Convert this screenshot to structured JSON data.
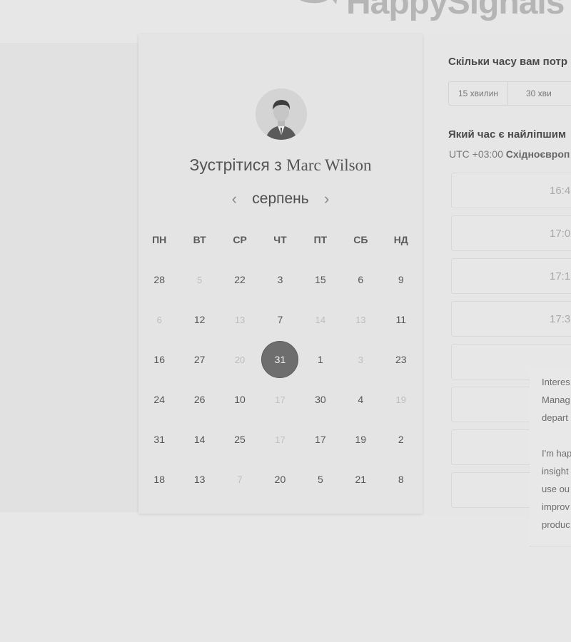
{
  "logo": {
    "text": "HappySignals"
  },
  "calendar": {
    "title_prefix": "Зустрітися з",
    "host_name": "Marc Wilson",
    "month": "серпень",
    "weekdays": [
      "ПН",
      "ВТ",
      "СР",
      "ЧТ",
      "ПТ",
      "СБ",
      "НД"
    ],
    "weeks": [
      [
        {
          "n": "28",
          "m": false
        },
        {
          "n": "5",
          "m": true
        },
        {
          "n": "22",
          "m": false
        },
        {
          "n": "3",
          "m": false
        },
        {
          "n": "15",
          "m": false
        },
        {
          "n": "6",
          "m": false
        },
        {
          "n": "9",
          "m": false
        }
      ],
      [
        {
          "n": "6",
          "m": true
        },
        {
          "n": "12",
          "m": false
        },
        {
          "n": "13",
          "m": true
        },
        {
          "n": "7",
          "m": false
        },
        {
          "n": "14",
          "m": true
        },
        {
          "n": "13",
          "m": true
        },
        {
          "n": "11",
          "m": false
        }
      ],
      [
        {
          "n": "16",
          "m": false
        },
        {
          "n": "27",
          "m": false
        },
        {
          "n": "20",
          "m": true
        },
        {
          "n": "31",
          "m": false,
          "s": true
        },
        {
          "n": "1",
          "m": false
        },
        {
          "n": "3",
          "m": true
        },
        {
          "n": "23",
          "m": false
        }
      ],
      [
        {
          "n": "24",
          "m": false
        },
        {
          "n": "26",
          "m": false
        },
        {
          "n": "10",
          "m": false
        },
        {
          "n": "17",
          "m": true
        },
        {
          "n": "30",
          "m": false
        },
        {
          "n": "4",
          "m": false
        },
        {
          "n": "19",
          "m": true
        }
      ],
      [
        {
          "n": "31",
          "m": false
        },
        {
          "n": "14",
          "m": false
        },
        {
          "n": "25",
          "m": false
        },
        {
          "n": "17",
          "m": true
        },
        {
          "n": "17",
          "m": false
        },
        {
          "n": "19",
          "m": false
        },
        {
          "n": "2",
          "m": false
        }
      ],
      [
        {
          "n": "18",
          "m": false
        },
        {
          "n": "13",
          "m": false
        },
        {
          "n": "7",
          "m": true
        },
        {
          "n": "20",
          "m": false
        },
        {
          "n": "5",
          "m": false
        },
        {
          "n": "21",
          "m": false
        },
        {
          "n": "8",
          "m": false
        }
      ]
    ]
  },
  "booking": {
    "duration_question": "Скільки часу вам потр",
    "durations": [
      "15 хвилин",
      "30 хви"
    ],
    "time_question": "Який час є найліпшим",
    "tz_prefix": "UTC +03:00",
    "tz_name": "Східноєвроп",
    "slots": [
      "16:4",
      "17:0",
      "17:1",
      "17:3",
      "",
      "",
      "",
      ""
    ]
  },
  "chat": {
    "lines": [
      "Interes",
      "Manag",
      "depart",
      "I'm hap",
      "insight",
      "use ou",
      "improv",
      "produc"
    ]
  }
}
